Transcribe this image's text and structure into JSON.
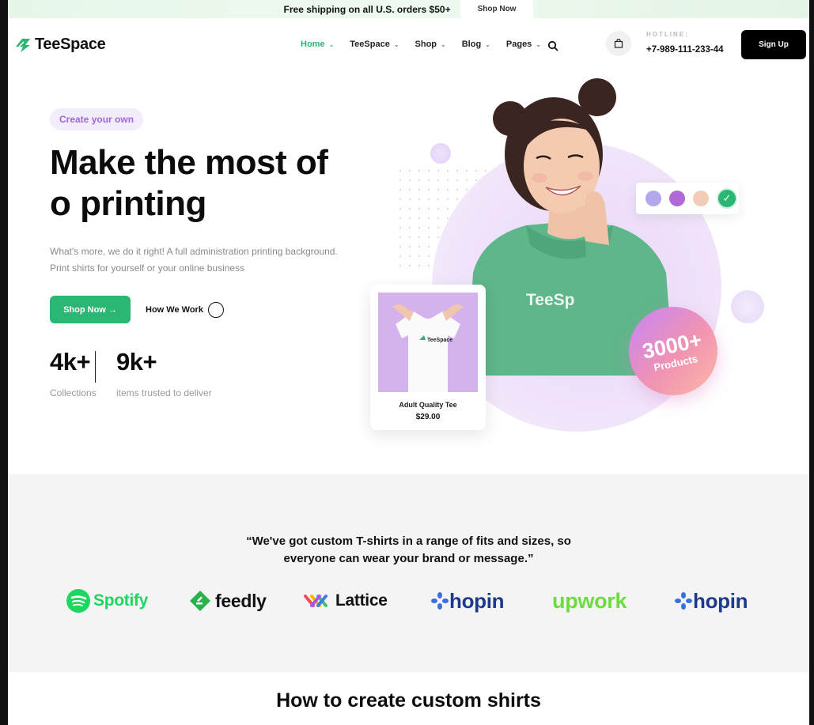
{
  "announcement": {
    "message": "Free shipping on all U.S. orders $50+",
    "cta": "Shop Now"
  },
  "header": {
    "logo": "TeeSpace",
    "nav": [
      {
        "label": "Home",
        "active": true
      },
      {
        "label": "TeeSpace",
        "active": false
      },
      {
        "label": "Shop",
        "active": false
      },
      {
        "label": "Blog",
        "active": false
      },
      {
        "label": "Pages",
        "active": false
      }
    ],
    "hotline_label": "HOTLINE:",
    "hotline_number": "+7-989-111-233-44",
    "signup": "Sign Up"
  },
  "hero": {
    "badge": "Create your own",
    "title_line1": "Make the most of",
    "title_line2": "o printing",
    "subtitle_line1": "What's more, we do it right! A full administration printing background.",
    "subtitle_line2": "Print shirts for yourself or your online business",
    "primary_cta": "Shop Now →",
    "secondary_cta": "How We Work",
    "stats": [
      {
        "value": "4k+",
        "label": "Collections"
      },
      {
        "value": "9k+",
        "label": "items trusted to deliver"
      }
    ],
    "hoodie_text": "TeeSp",
    "color_swatches": [
      "#b4a8ec",
      "#b06ad8",
      "#f1cdb8"
    ],
    "accent_color": "#2bb673",
    "products_badge": {
      "value": "3000+",
      "label": "Products"
    },
    "product_card": {
      "name": "Adult Quality Tee",
      "price": "$29.00",
      "shirt_brand": "TeeSpace"
    }
  },
  "brands_section": {
    "quote_line1": "“We've got custom T-shirts in a range of fits and sizes, so",
    "quote_line2": "everyone can wear your brand or message.”",
    "brands": [
      {
        "name": "Spotify",
        "color": "#1ed760"
      },
      {
        "name": "feedly",
        "color": "#2bb24c"
      },
      {
        "name": "Lattice",
        "color": "#111111"
      },
      {
        "name": "hopin",
        "color": "#1d3a8a"
      },
      {
        "name": "upwork",
        "color": "#6fda44"
      },
      {
        "name": "hopin",
        "color": "#1d3a8a"
      }
    ]
  },
  "next_section": {
    "title": "How to create custom shirts"
  }
}
